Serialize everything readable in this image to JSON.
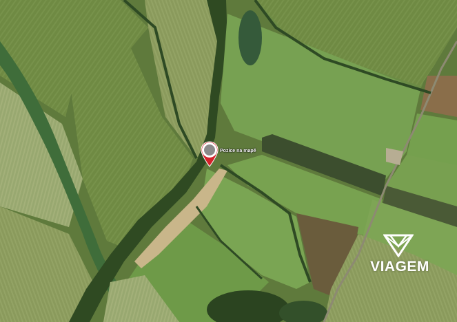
{
  "map": {
    "type": "satellite",
    "marker": {
      "label": "Pozice na mapě",
      "color": "#d4222a"
    },
    "branding": {
      "logo_text": "VIAGEM",
      "icon": "viagem-diamond-logo-icon"
    }
  }
}
